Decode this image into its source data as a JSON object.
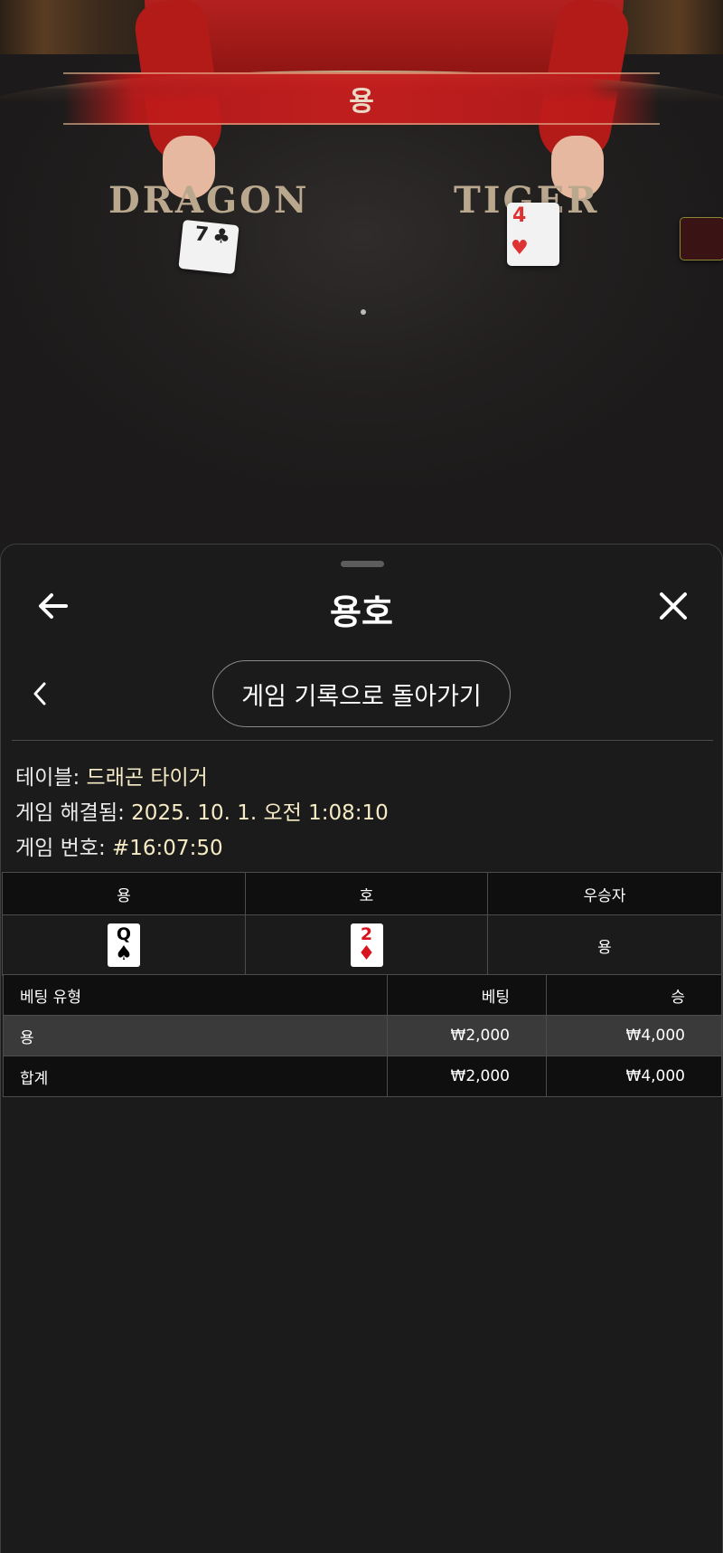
{
  "video": {
    "result_banner": "용",
    "dragon_label": "DRAGON",
    "tiger_label": "TIGER",
    "dragon_card": {
      "rank": "7",
      "suit": "♣"
    },
    "tiger_card": {
      "rank": "4",
      "suit": "♥"
    }
  },
  "header": {
    "title": "용호",
    "back_icon": "arrow-left-icon",
    "close_icon": "close-icon"
  },
  "nav": {
    "prev_icon": "chevron-left-icon",
    "history_button": "게임 기록으로 돌아가기"
  },
  "info": {
    "table_label": "테이블: ",
    "table_value": "드래곤 타이거",
    "resolved_label": "게임 해결됨: ",
    "resolved_value": "2025. 10. 1. 오전 1:08:10",
    "number_label": "게임 번호: ",
    "number_value": "#16:07:50"
  },
  "result": {
    "headers": [
      "용",
      "호",
      "우승자"
    ],
    "dragon_card": {
      "rank": "Q",
      "suit": "♠",
      "color": "#000000"
    },
    "tiger_card": {
      "rank": "2",
      "suit": "♦",
      "color": "#d8141e"
    },
    "winner": "용"
  },
  "bets": {
    "headers": [
      "베팅 유형",
      "베팅",
      "승"
    ],
    "rows": [
      {
        "type": "용",
        "bet": "₩2,000",
        "win": "₩4,000"
      },
      {
        "type": "합계",
        "bet": "₩2,000",
        "win": "₩4,000"
      }
    ]
  }
}
